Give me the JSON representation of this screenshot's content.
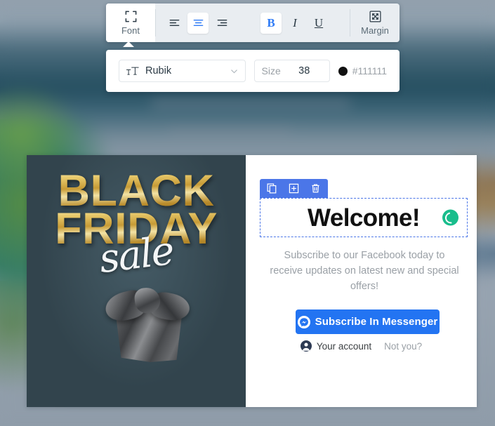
{
  "toolbar": {
    "font_button": {
      "label": "Font",
      "icon": "expand-corners-icon",
      "active": true
    },
    "align": [
      {
        "name": "align-left",
        "glyph": "≡",
        "selected": false
      },
      {
        "name": "align-center",
        "glyph": "≡",
        "selected": true
      },
      {
        "name": "align-right",
        "glyph": "≡",
        "selected": false
      }
    ],
    "styles": [
      {
        "name": "bold",
        "glyph": "B",
        "selected": true
      },
      {
        "name": "italic",
        "glyph": "I",
        "selected": false
      },
      {
        "name": "underline",
        "glyph": "U",
        "selected": false
      }
    ],
    "margin_button": {
      "label": "Margin",
      "icon": "expand-arrows-icon"
    },
    "accent_color": "#2f7bf6"
  },
  "font_panel": {
    "font_icon": "text-size-icon",
    "font_name": "Rubik",
    "dropdown_icon": "chevron-down-icon",
    "size_label": "Size",
    "size_value": "38",
    "color_hex": "#111111",
    "color_swatch": "#111111"
  },
  "block_toolbar": {
    "duplicate": {
      "label": "Duplicate block",
      "icon": "copy-icon"
    },
    "add": {
      "label": "Add block",
      "icon": "plus-square-icon"
    },
    "delete": {
      "label": "Delete block",
      "icon": "trash-icon"
    },
    "background": "#4b76e8"
  },
  "card": {
    "image": {
      "title_line1": "BLACK",
      "title_line2": "FRIDAY",
      "script_word": "sale",
      "background": "#32444d",
      "gold": "#e8c96b"
    },
    "heading": "Welcome!",
    "spinner_color": "#19bd8c",
    "body_text": "Subscribe to our Facebook today to receive updates on latest new and special offers!",
    "messenger_button": {
      "label": "Subscribe In Messenger",
      "icon": "messenger-icon",
      "color": "#2374f2"
    },
    "account": {
      "avatar_icon": "user-avatar-icon",
      "name": "Your account",
      "not_you": "Not you?"
    }
  }
}
